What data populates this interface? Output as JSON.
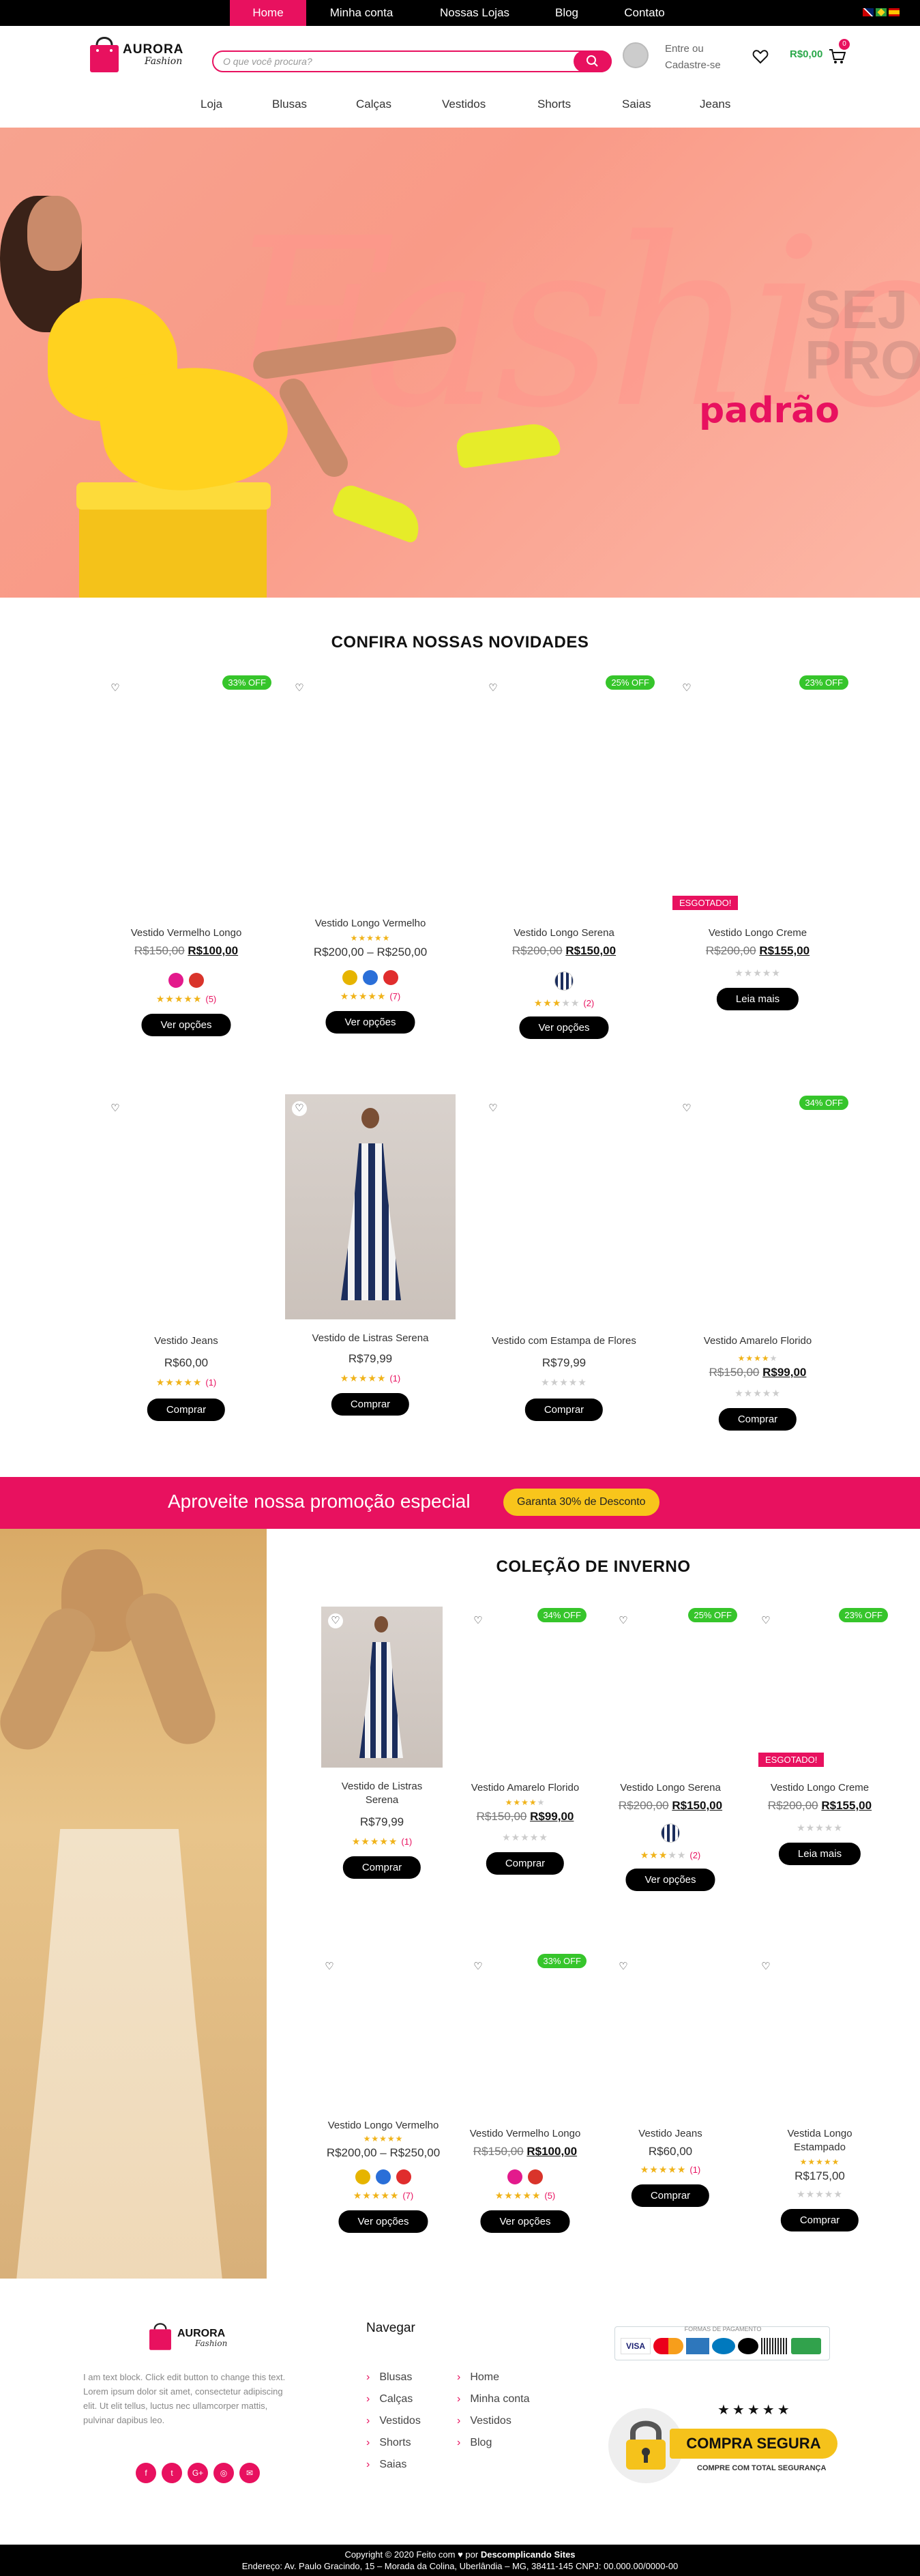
{
  "topnav": {
    "items": [
      "Home",
      "Minha conta",
      "Nossas Lojas",
      "Blog",
      "Contato"
    ]
  },
  "header": {
    "logo_brand": "AURORA",
    "logo_sub": "Fashion",
    "search_placeholder": "O que você procura?",
    "login_line1": "Entre ou",
    "login_line2": "Cadastre-se",
    "cart_total": "R$0,00",
    "cart_count": "0"
  },
  "catnav": [
    "Loja",
    "Blusas",
    "Calças",
    "Vestidos",
    "Shorts",
    "Saias",
    "Jeans"
  ],
  "hero": {
    "script_word": "Fashion",
    "big_text_1": "SEJ",
    "big_text_2": "PRO",
    "accent": "padrão"
  },
  "novidades": {
    "title": "CONFIRA NOSSAS NOVIDADES",
    "row1": [
      {
        "name": "Vestido Vermelho Longo",
        "old": "R$150,00",
        "new": "R$100,00",
        "badge": "33% OFF",
        "reviews": "(5)",
        "button": "Ver opções",
        "swatches": [
          "#e31a8c",
          "#d9342b"
        ]
      },
      {
        "name": "Vestido Longo Vermelho",
        "range": "R$200,00 – R$250,00",
        "reviews": "(7)",
        "button": "Ver opções",
        "swatches": [
          "#e6b400",
          "#2a6fd8",
          "#e02d2d"
        ]
      },
      {
        "name": "Vestido Longo Serena",
        "old": "R$200,00",
        "new": "R$150,00",
        "badge": "25% OFF",
        "reviews": "(2)",
        "button": "Ver opções"
      },
      {
        "name": "Vestido Longo Creme",
        "old": "R$200,00",
        "new": "R$155,00",
        "badge": "23% OFF",
        "button": "Leia mais",
        "soldout": "ESGOTADO!"
      }
    ],
    "row2": [
      {
        "name": "Vestido Jeans",
        "price": "R$60,00",
        "reviews": "(1)",
        "button": "Comprar"
      },
      {
        "name": "Vestido de Listras Serena",
        "price": "R$79,99",
        "reviews": "(1)",
        "button": "Comprar"
      },
      {
        "name": "Vestido com Estampa de Flores",
        "price": "R$79,99",
        "button": "Comprar"
      },
      {
        "name": "Vestido Amarelo Florido",
        "old": "R$150,00",
        "new": "R$99,00",
        "badge": "34% OFF",
        "button": "Comprar"
      }
    ]
  },
  "promo": {
    "text": "Aproveite nossa promoção especial",
    "button": "Garanta 30% de Desconto"
  },
  "inverno": {
    "title": "COLEÇÃO DE INVERNO",
    "row1": [
      {
        "name1": "Vestido de Listras",
        "name2": "Serena",
        "price": "R$79,99",
        "reviews": "(1)",
        "button": "Comprar"
      },
      {
        "name1": "Vestido Amarelo Florido",
        "old": "R$150,00",
        "new": "R$99,00",
        "badge": "34% OFF",
        "button": "Comprar"
      },
      {
        "name1": "Vestido Longo Serena",
        "old": "R$200,00",
        "new": "R$150,00",
        "badge": "25% OFF",
        "reviews": "(2)",
        "button": "Ver opções"
      },
      {
        "name1": "Vestido Longo Creme",
        "old": "R$200,00",
        "new": "R$155,00",
        "badge": "23% OFF",
        "button": "Leia mais",
        "soldout": "ESGOTADO!"
      }
    ],
    "row2": [
      {
        "name1": "Vestido Longo Vermelho",
        "range": "R$200,00 – R$250,00",
        "reviews": "(7)",
        "button": "Ver opções"
      },
      {
        "name1": "Vestido Vermelho Longo",
        "old": "R$150,00",
        "new": "R$100,00",
        "badge": "33% OFF",
        "reviews": "(5)",
        "button": "Ver opções"
      },
      {
        "name1": "Vestido Jeans",
        "price": "R$60,00",
        "reviews": "(1)",
        "button": "Comprar"
      },
      {
        "name1": "Vestida Longo",
        "name2": "Estampado",
        "price": "R$175,00",
        "button": "Comprar"
      }
    ]
  },
  "footer": {
    "about": "I am text block. Click edit button to change this text. Lorem ipsum dolor sit amet, consectetur adipiscing elit. Ut elit tellus, luctus nec ullamcorper mattis, pulvinar dapibus leo.",
    "nav_title": "Navegar",
    "nav_col1": [
      "Blusas",
      "Calças",
      "Vestidos",
      "Shorts",
      "Saias"
    ],
    "nav_col2": [
      "Home",
      "Minha conta",
      "Vestidos",
      "Blog"
    ],
    "payment_title": "FORMAS DE PAGAMENTO",
    "payment_cards": [
      "VISA",
      "",
      "",
      "",
      "",
      "",
      ""
    ],
    "secure_title": "COMPRA SEGURA",
    "secure_sub": "COMPRE COM TOTAL SEGURANÇA",
    "social": [
      "f",
      "t",
      "G+",
      "◎",
      "✉"
    ]
  },
  "bottom": {
    "line1_a": "Copyright © 2020 Feito com ♥ por ",
    "line1_b": "Descomplicando Sites",
    "line2": "Endereço: Av. Paulo Gracindo, 15 – Morada da Colina, Uberlândia – MG, 38411-145 CNPJ: 00.000.00/0000-00"
  },
  "colors": {
    "accent": "#e8115f",
    "sale": "#36c52b",
    "stars": "#f0b31a",
    "promo_button": "#f8c51b"
  }
}
